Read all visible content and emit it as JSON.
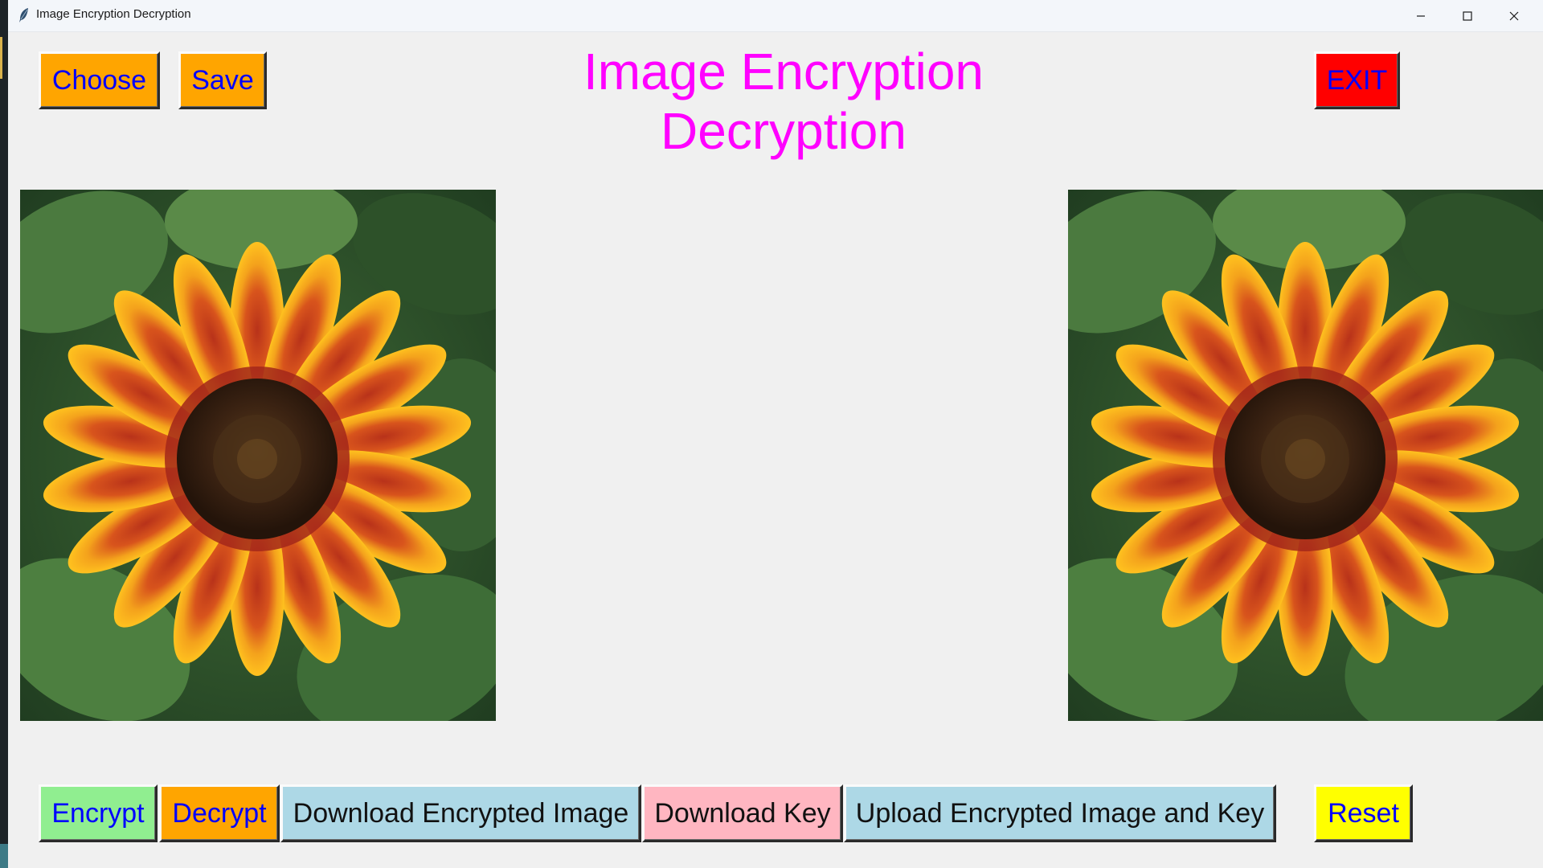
{
  "window": {
    "title": "Image Encryption Decryption"
  },
  "toolbar": {
    "choose_label": "Choose",
    "save_label": "Save",
    "exit_label": "EXIT"
  },
  "heading": {
    "line1": "Image Encryption",
    "line2": "Decryption"
  },
  "images": {
    "left": "sunflower-image",
    "right": "sunflower-image"
  },
  "actions": {
    "encrypt_label": "Encrypt",
    "decrypt_label": "Decrypt",
    "download_encrypted_label": "Download Encrypted Image",
    "download_key_label": "Download Key",
    "upload_label": "Upload Encrypted Image and Key",
    "reset_label": "Reset"
  },
  "colors": {
    "choose_bg": "#ffa500",
    "save_bg": "#ffa500",
    "exit_bg": "#ff0000",
    "encrypt_bg": "#90ee90",
    "decrypt_bg": "#ffa500",
    "download_encrypted_bg": "#add8e6",
    "download_key_bg": "#ffb6c1",
    "upload_bg": "#add8e6",
    "reset_bg": "#ffff00",
    "heading_color": "#ff00ff",
    "button_text_blue": "#0000ff"
  }
}
